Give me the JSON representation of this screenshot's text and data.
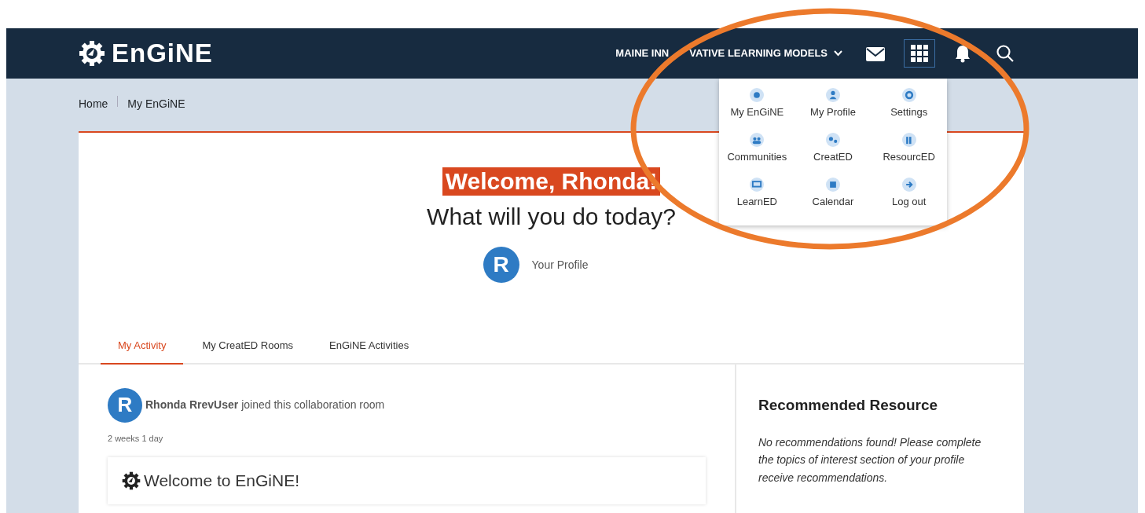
{
  "brand": {
    "name": "EnGiNE"
  },
  "nav": {
    "organization_parts": [
      "MAINE INN",
      "VATIVE LEARNING MODELS"
    ],
    "apps_open": true
  },
  "app_menu": [
    {
      "label": "My EnGiNE"
    },
    {
      "label": "My Profile"
    },
    {
      "label": "Settings"
    },
    {
      "label": "Communities"
    },
    {
      "label": "CreatED"
    },
    {
      "label": "ResourcED"
    },
    {
      "label": "LearnED"
    },
    {
      "label": "Calendar"
    },
    {
      "label": "Log out"
    }
  ],
  "breadcrumb": [
    {
      "label": "Home"
    },
    {
      "label": "My EnGiNE"
    }
  ],
  "welcome": {
    "greeting": "Welcome, Rhonda!",
    "question": "What will you do today?"
  },
  "profile": {
    "initial": "R",
    "link": "Your Profile"
  },
  "tabs": [
    {
      "label": "My Activity",
      "selected": true
    },
    {
      "label": "My CreatED Rooms",
      "selected": false
    },
    {
      "label": "EnGiNE Activities",
      "selected": false
    }
  ],
  "activity": {
    "initial": "R",
    "message": "**Rhonda RrevUser** joined this collaboration room",
    "time": "2 weeks 1 day",
    "post_title": "Welcome to EnGiNE!"
  },
  "sidebar": {
    "title": "Recommended Resource",
    "message": "No recommendations found! Please complete the topics of interest section of your profile receive recommendations."
  }
}
